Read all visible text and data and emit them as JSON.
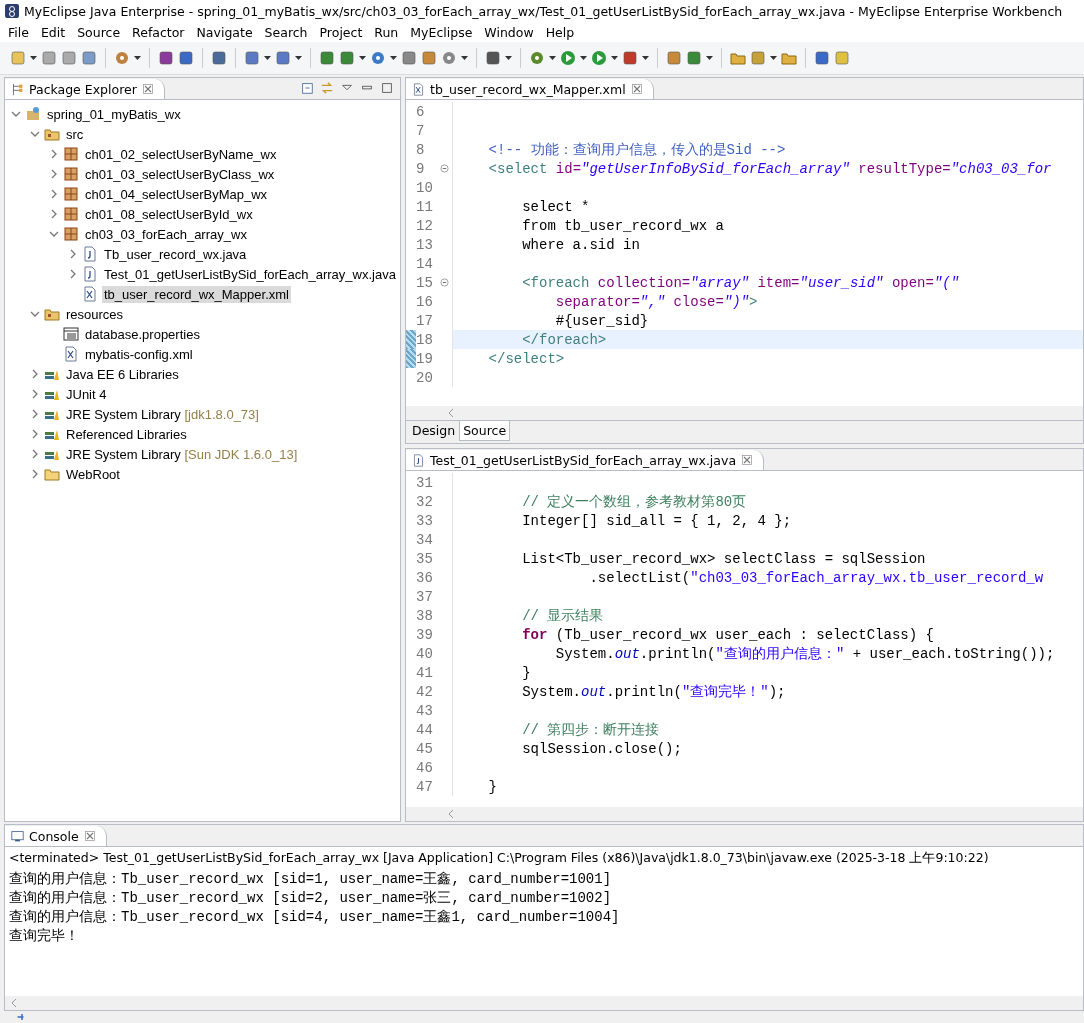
{
  "window": {
    "title": "MyEclipse Java Enterprise - spring_01_myBatis_wx/src/ch03_03_forEach_array_wx/Test_01_getUserListBySid_forEach_array_wx.java - MyEclipse Enterprise Workbench"
  },
  "menu": [
    "File",
    "Edit",
    "Source",
    "Refactor",
    "Navigate",
    "Search",
    "Project",
    "Run",
    "MyEclipse",
    "Window",
    "Help"
  ],
  "explorer": {
    "title": "Package Explorer",
    "tree": [
      {
        "label": "spring_01_myBatis_wx",
        "kind": "project",
        "expanded": true,
        "selected": false,
        "children": [
          {
            "label": "src",
            "kind": "source-folder",
            "expanded": true,
            "selected": false,
            "children": [
              {
                "label": "ch01_02_selectUserByName_wx",
                "kind": "package",
                "expanded": false,
                "selected": false
              },
              {
                "label": "ch01_03_selectUserByClass_wx",
                "kind": "package",
                "expanded": false,
                "selected": false
              },
              {
                "label": "ch01_04_selectUserByMap_wx",
                "kind": "package",
                "expanded": false,
                "selected": false
              },
              {
                "label": "ch01_08_selectUserById_wx",
                "kind": "package",
                "expanded": false,
                "selected": false
              },
              {
                "label": "ch03_03_forEach_array_wx",
                "kind": "package",
                "expanded": true,
                "selected": false,
                "children": [
                  {
                    "label": "Tb_user_record_wx.java",
                    "kind": "java",
                    "expanded": false,
                    "selected": false
                  },
                  {
                    "label": "Test_01_getUserListBySid_forEach_array_wx.java",
                    "kind": "java",
                    "expanded": false,
                    "selected": false
                  },
                  {
                    "label": "tb_user_record_wx_Mapper.xml",
                    "kind": "xml",
                    "selected": true
                  }
                ]
              }
            ]
          },
          {
            "label": "resources",
            "kind": "source-folder",
            "expanded": true,
            "selected": false,
            "children": [
              {
                "label": "database.properties",
                "kind": "properties",
                "selected": false
              },
              {
                "label": "mybatis-config.xml",
                "kind": "xml",
                "selected": false
              }
            ]
          },
          {
            "label": "Java EE 6 Libraries",
            "kind": "library",
            "expanded": false,
            "selected": false
          },
          {
            "label": "JUnit 4",
            "kind": "library",
            "expanded": false,
            "selected": false
          },
          {
            "label": "JRE System Library",
            "decoration": "[jdk1.8.0_73]",
            "kind": "library",
            "expanded": false,
            "selected": false
          },
          {
            "label": "Referenced Libraries",
            "kind": "library",
            "expanded": false,
            "selected": false
          },
          {
            "label": "JRE System Library",
            "decoration": "[Sun JDK 1.6.0_13]",
            "kind": "library",
            "expanded": false,
            "selected": false
          },
          {
            "label": "WebRoot",
            "kind": "folder",
            "expanded": false,
            "selected": false
          }
        ]
      }
    ]
  },
  "xml_editor": {
    "tab": "tb_user_record_wx_Mapper.xml",
    "bottom_tabs": [
      {
        "label": "Design",
        "selected": false
      },
      {
        "label": "Source",
        "selected": true
      }
    ],
    "lines": [
      {
        "number": "6",
        "current": false,
        "marked": false,
        "foldable": false
      },
      {
        "number": "7",
        "current": false,
        "marked": false,
        "foldable": false
      },
      {
        "number": "8",
        "current": false,
        "marked": false,
        "foldable": false,
        "segments": [
          {
            "kind": "comment",
            "text": "    <!-- 功能：查询用户信息，传入的是Sid -->"
          }
        ]
      },
      {
        "number": "9",
        "current": false,
        "marked": false,
        "foldable": true,
        "segments": [
          {
            "kind": "tag",
            "text": "    <select"
          },
          {
            "kind": "attr",
            "text": " id="
          },
          {
            "kind": "string",
            "text": "\"getUserInfoBySid_forEach_array\""
          },
          {
            "kind": "attr",
            "text": " resultType="
          },
          {
            "kind": "string",
            "text": "\"ch03_03_for"
          }
        ]
      },
      {
        "number": "10",
        "current": false,
        "marked": false,
        "foldable": false
      },
      {
        "number": "11",
        "current": false,
        "marked": false,
        "foldable": false,
        "segments": [
          {
            "kind": "plain",
            "text": "        select *"
          }
        ]
      },
      {
        "number": "12",
        "current": false,
        "marked": false,
        "foldable": false,
        "segments": [
          {
            "kind": "plain",
            "text": "        from tb_user_record_wx a"
          }
        ]
      },
      {
        "number": "13",
        "current": false,
        "marked": false,
        "foldable": false,
        "segments": [
          {
            "kind": "plain",
            "text": "        where a.sid in"
          }
        ]
      },
      {
        "number": "14",
        "current": false,
        "marked": false,
        "foldable": false
      },
      {
        "number": "15",
        "current": false,
        "marked": false,
        "foldable": true,
        "segments": [
          {
            "kind": "tag",
            "text": "        <foreach"
          },
          {
            "kind": "attr",
            "text": " collection="
          },
          {
            "kind": "string",
            "text": "\"array\""
          },
          {
            "kind": "attr",
            "text": " item="
          },
          {
            "kind": "string",
            "text": "\"user_sid\""
          },
          {
            "kind": "attr",
            "text": " open="
          },
          {
            "kind": "string",
            "text": "\"(\""
          }
        ]
      },
      {
        "number": "16",
        "current": false,
        "marked": false,
        "foldable": false,
        "segments": [
          {
            "kind": "attr",
            "text": "            separator="
          },
          {
            "kind": "string",
            "text": "\",\""
          },
          {
            "kind": "attr",
            "text": " close="
          },
          {
            "kind": "string",
            "text": "\")\""
          },
          {
            "kind": "tag",
            "text": ">"
          }
        ]
      },
      {
        "number": "17",
        "current": false,
        "marked": false,
        "foldable": false,
        "segments": [
          {
            "kind": "plain",
            "text": "            #{user_sid}"
          }
        ]
      },
      {
        "number": "18",
        "current": true,
        "marked": true,
        "foldable": false,
        "segments": [
          {
            "kind": "tag",
            "text": "        </foreach>"
          }
        ]
      },
      {
        "number": "19",
        "current": false,
        "marked": true,
        "foldable": false,
        "segments": [
          {
            "kind": "tag",
            "text": "    </select>"
          }
        ]
      },
      {
        "number": "20",
        "current": false,
        "marked": false,
        "foldable": false
      }
    ]
  },
  "java_editor": {
    "tab": "Test_01_getUserListBySid_forEach_array_wx.java",
    "lines": [
      {
        "number": "31"
      },
      {
        "number": "32",
        "segments": [
          {
            "kind": "comment",
            "text": "        // 定义一个数组，参考教材第80页"
          }
        ]
      },
      {
        "number": "33",
        "segments": [
          {
            "kind": "plain",
            "text": "        Integer[] sid_all = { 1, 2, 4 };"
          }
        ]
      },
      {
        "number": "34"
      },
      {
        "number": "35",
        "segments": [
          {
            "kind": "plain",
            "text": "        List<Tb_user_record_wx> selectClass = sqlSession"
          }
        ]
      },
      {
        "number": "36",
        "segments": [
          {
            "kind": "plain",
            "text": "                .selectList("
          },
          {
            "kind": "string",
            "text": "\"ch03_03_forEach_array_wx.tb_user_record_w"
          }
        ]
      },
      {
        "number": "37"
      },
      {
        "number": "38",
        "segments": [
          {
            "kind": "comment",
            "text": "        // 显示结果"
          }
        ]
      },
      {
        "number": "39",
        "segments": [
          {
            "kind": "keyword",
            "text": "        for"
          },
          {
            "kind": "plain",
            "text": " (Tb_user_record_wx user_each : selectClass) {"
          }
        ]
      },
      {
        "number": "40",
        "segments": [
          {
            "kind": "plain",
            "text": "            System."
          },
          {
            "kind": "field",
            "text": "out"
          },
          {
            "kind": "plain",
            "text": ".println("
          },
          {
            "kind": "string",
            "text": "\"查询的用户信息：\""
          },
          {
            "kind": "plain",
            "text": " + user_each.toString());"
          }
        ]
      },
      {
        "number": "41",
        "segments": [
          {
            "kind": "plain",
            "text": "        }"
          }
        ]
      },
      {
        "number": "42",
        "segments": [
          {
            "kind": "plain",
            "text": "        System."
          },
          {
            "kind": "field",
            "text": "out"
          },
          {
            "kind": "plain",
            "text": ".println("
          },
          {
            "kind": "string",
            "text": "\"查询完毕！\""
          },
          {
            "kind": "plain",
            "text": ");"
          }
        ]
      },
      {
        "number": "43"
      },
      {
        "number": "44",
        "segments": [
          {
            "kind": "comment",
            "text": "        // 第四步：断开连接"
          }
        ]
      },
      {
        "number": "45",
        "segments": [
          {
            "kind": "plain",
            "text": "        sqlSession.close();"
          }
        ]
      },
      {
        "number": "46"
      },
      {
        "number": "47",
        "segments": [
          {
            "kind": "plain",
            "text": "    }"
          }
        ]
      }
    ]
  },
  "console": {
    "title": "Console",
    "header": "<terminated> Test_01_getUserListBySid_forEach_array_wx [Java Application] C:\\Program Files (x86)\\Java\\jdk1.8.0_73\\bin\\javaw.exe (2025-3-18 上午9:10:22)",
    "lines": [
      "查询的用户信息：Tb_user_record_wx [sid=1, user_name=王鑫, card_number=1001]",
      "查询的用户信息：Tb_user_record_wx [sid=2, user_name=张三, card_number=1002]",
      "查询的用户信息：Tb_user_record_wx [sid=4, user_name=王鑫1, card_number=1004]",
      "查询完毕！"
    ]
  }
}
